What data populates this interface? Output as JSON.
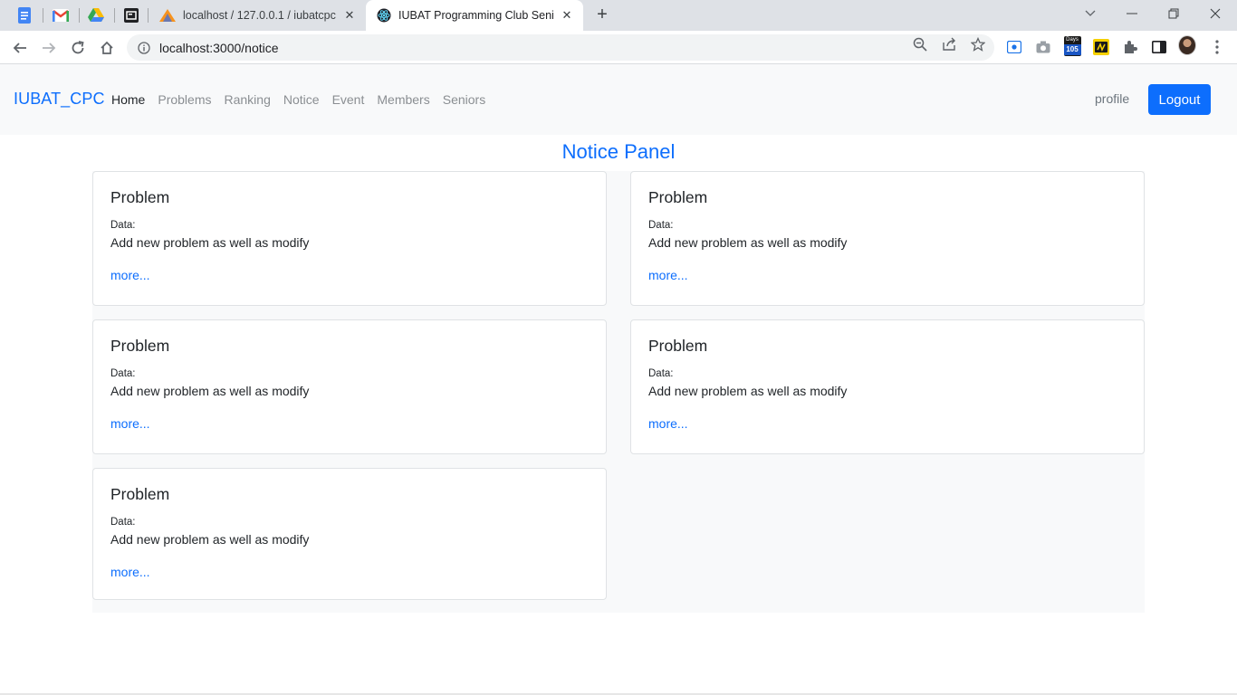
{
  "browser": {
    "tabs": [
      {
        "title": "localhost / 127.0.0.1 / iubatcpc /",
        "favicon": "phpmyadmin-icon"
      },
      {
        "title": "IUBAT Programming Club Senior",
        "favicon": "react-icon"
      }
    ],
    "address": "localhost:3000/notice"
  },
  "navbar": {
    "brand": "IUBAT_CPC",
    "links": [
      "Home",
      "Problems",
      "Ranking",
      "Notice",
      "Event",
      "Members",
      "Seniors"
    ],
    "active_link": "Home",
    "profile_label": "profile",
    "logout_label": "Logout"
  },
  "notice_panel": {
    "title": "Notice Panel",
    "cards": [
      {
        "title": "Problem",
        "data_label": "Data:",
        "text": "Add new problem as well as modify",
        "link": "more..."
      },
      {
        "title": "Problem",
        "data_label": "Data:",
        "text": "Add new problem as well as modify",
        "link": "more..."
      },
      {
        "title": "Problem",
        "data_label": "Data:",
        "text": "Add new problem as well as modify",
        "link": "more..."
      },
      {
        "title": "Problem",
        "data_label": "Data:",
        "text": "Add new problem as well as modify",
        "link": "more..."
      },
      {
        "title": "Problem",
        "data_label": "Data:",
        "text": "Add new problem as well as modify",
        "link": "more..."
      }
    ]
  },
  "extension": {
    "days_top": "Days",
    "days_count": "105"
  },
  "colors": {
    "accent": "#0d6efd",
    "navbar_bg": "#f8f9fa"
  }
}
